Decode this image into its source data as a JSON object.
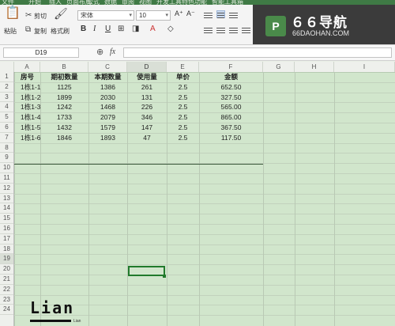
{
  "menu_strip": {
    "items": [
      "文件",
      "开始",
      "插入",
      "页面布局",
      "公式",
      "数据",
      "审阅",
      "视图",
      "开发工具",
      "特色功能",
      "智能工具箱"
    ]
  },
  "ribbon": {
    "paste_label": "粘贴",
    "cut_label": "剪切",
    "copy_label": "复制",
    "format_painter_label": "格式刷",
    "font_name": "宋体",
    "font_size": "10",
    "bold": "B",
    "italic": "I",
    "underline": "U"
  },
  "logo": {
    "badge": "P",
    "main": "６６导航",
    "sub": "66DAOHAN.COM"
  },
  "formula_bar": {
    "name_box": "D19",
    "fx": "fx",
    "zoom_icon": "magnifier-icon",
    "formula": ""
  },
  "grid": {
    "columns": [
      "A",
      "B",
      "C",
      "D",
      "E",
      "F",
      "G",
      "H",
      "I"
    ],
    "rows": [
      "1",
      "2",
      "3",
      "4",
      "5",
      "6",
      "7",
      "8",
      "9",
      "10",
      "11",
      "12",
      "13",
      "14",
      "15",
      "16",
      "17",
      "18",
      "19",
      "20",
      "21",
      "22",
      "23",
      "24"
    ],
    "selected_cell": "D19"
  },
  "table": {
    "headers": [
      "房号",
      "期初数量",
      "本期数量",
      "使用量",
      "单价",
      "金额"
    ],
    "rows": [
      [
        "1栋1-1",
        "1125",
        "1386",
        "261",
        "2.5",
        "652.50"
      ],
      [
        "1栋1-2",
        "1899",
        "2030",
        "131",
        "2.5",
        "327.50"
      ],
      [
        "1栋1-3",
        "1242",
        "1468",
        "226",
        "2.5",
        "565.00"
      ],
      [
        "1栋1-4",
        "1733",
        "2079",
        "346",
        "2.5",
        "865.00"
      ],
      [
        "1栋1-5",
        "1432",
        "1579",
        "147",
        "2.5",
        "367.50"
      ],
      [
        "1栋1-6",
        "1846",
        "1893",
        "47",
        "2.5",
        "117.50"
      ]
    ]
  },
  "signature": {
    "text": "Lian",
    "small": "Lian"
  },
  "colors": {
    "cell_bg": "#d1e6cc",
    "selection": "#217a2c",
    "logo_bg": "#3b3b3b"
  }
}
